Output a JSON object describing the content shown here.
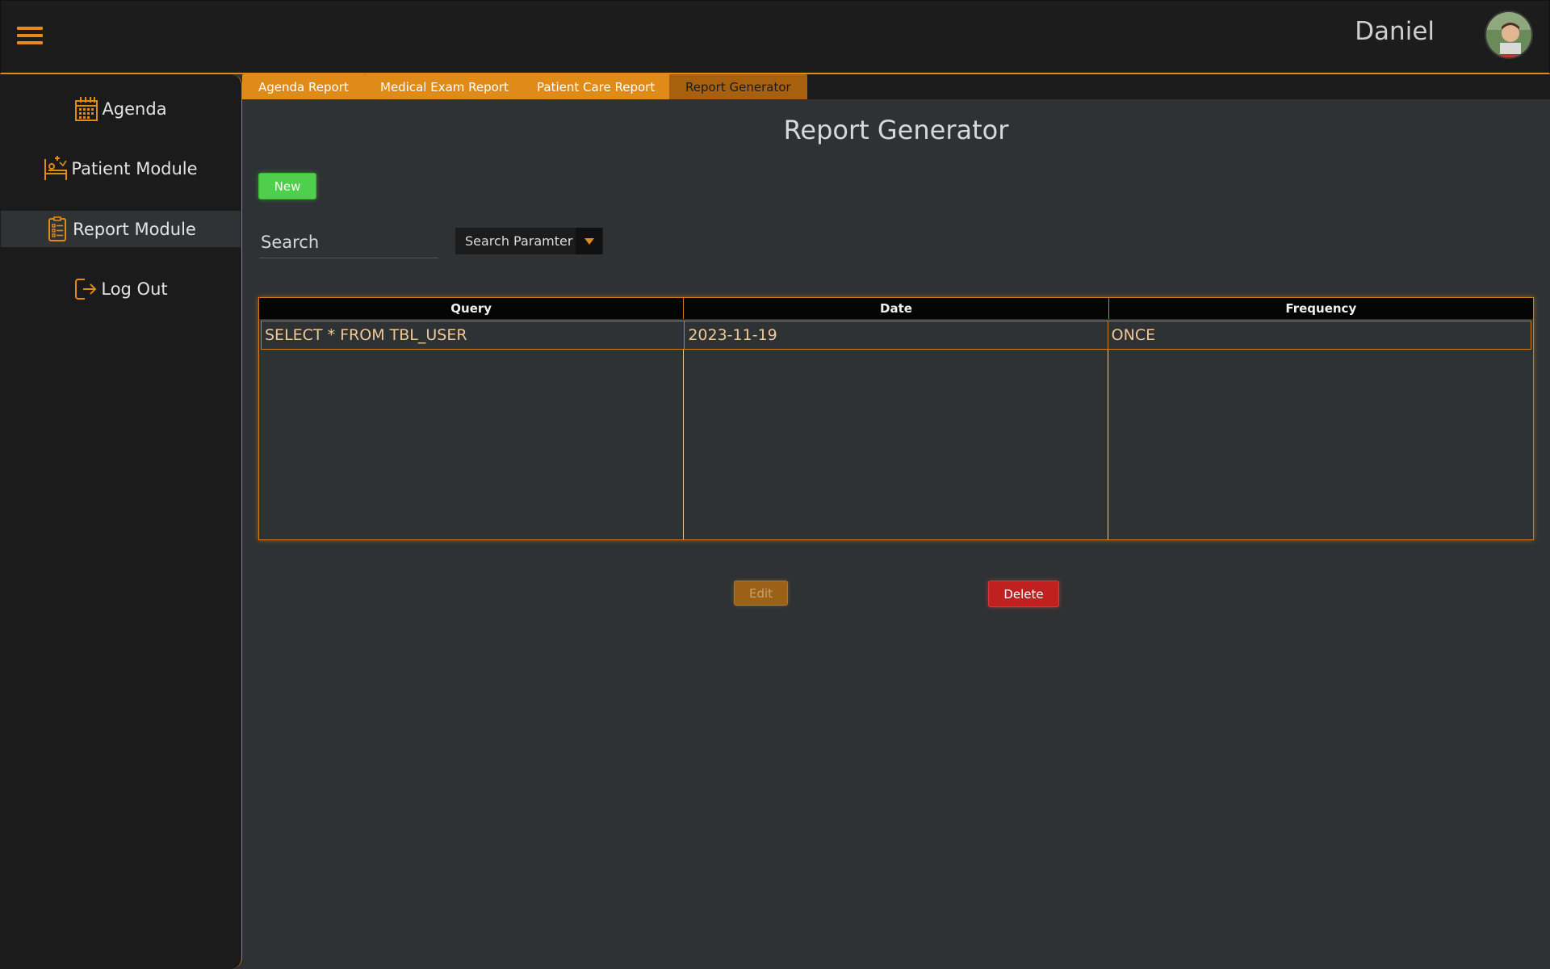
{
  "header": {
    "menu_icon": "hamburger-menu-icon",
    "username": "Daniel",
    "avatar_icon": "user-avatar"
  },
  "sidebar": {
    "items": [
      {
        "label": "Agenda",
        "icon": "calendar-icon",
        "active": false
      },
      {
        "label": "Patient Module",
        "icon": "hospital-bed-icon",
        "active": false
      },
      {
        "label": "Report Module",
        "icon": "report-document-icon",
        "active": true
      },
      {
        "label": "Log Out",
        "icon": "logout-icon",
        "active": false
      }
    ]
  },
  "tabs": [
    {
      "label": "Agenda Report",
      "active": false
    },
    {
      "label": "Medical Exam Report",
      "active": false
    },
    {
      "label": "Patient Care Report",
      "active": false
    },
    {
      "label": "Report Generator",
      "active": true
    }
  ],
  "main": {
    "title": "Report Generator",
    "new_label": "New",
    "search_placeholder": "Search",
    "search_param_label": "Search Paramter",
    "edit_label": "Edit",
    "delete_label": "Delete"
  },
  "table": {
    "headers": [
      "Query",
      "Date",
      "Frequency"
    ],
    "rows": [
      [
        "SELECT * FROM TBL_USER",
        "2023-11-19",
        "ONCE"
      ]
    ]
  },
  "colors": {
    "accent": "#e08a18",
    "new_button": "#4fcf4c",
    "delete_button": "#c02020",
    "edit_button": "#9b6116",
    "background": "#2e3234",
    "sidebar": "#1b1b1b"
  }
}
